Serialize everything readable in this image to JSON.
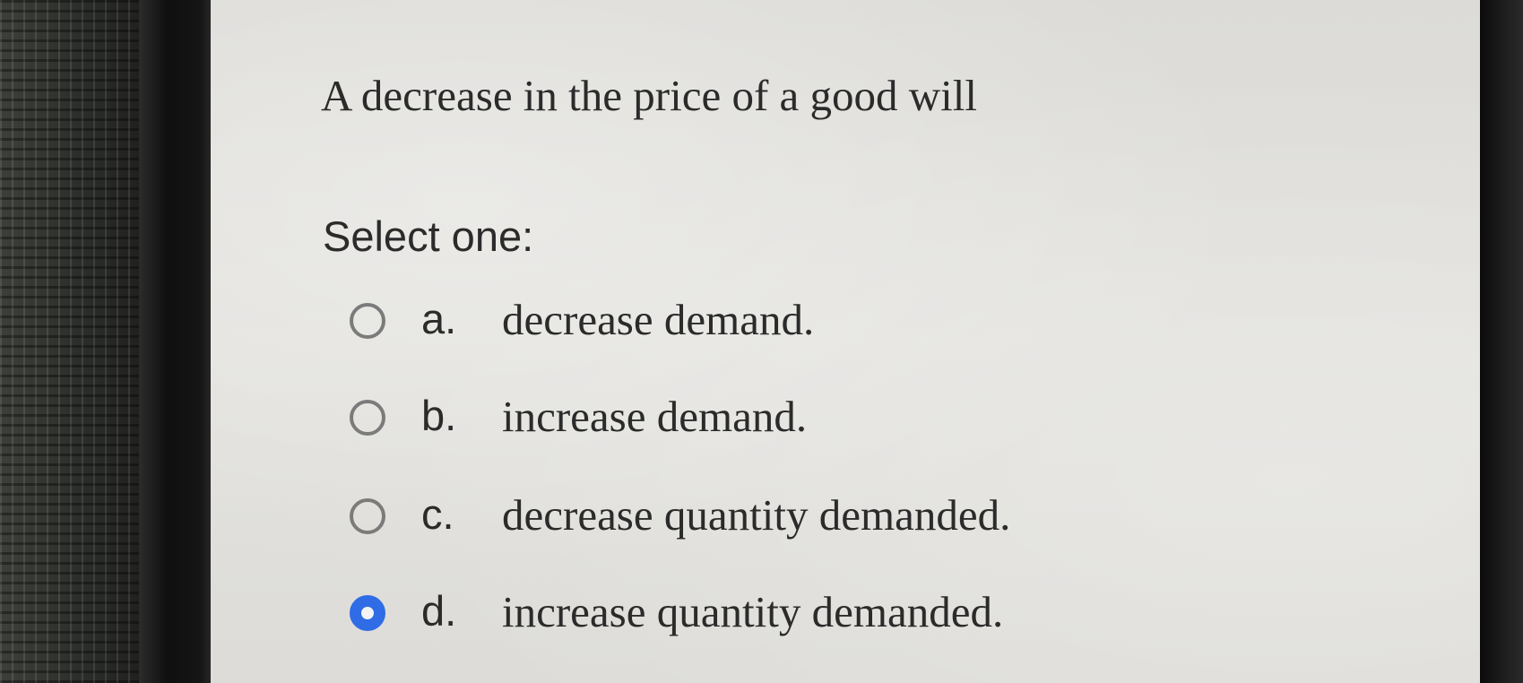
{
  "question": {
    "text": "A decrease in the price of a good will"
  },
  "prompt": "Select one:",
  "options": [
    {
      "letter": "a.",
      "text": "decrease demand.",
      "selected": false
    },
    {
      "letter": "b.",
      "text": "increase demand.",
      "selected": false
    },
    {
      "letter": "c.",
      "text": "decrease quantity demanded.",
      "selected": false
    },
    {
      "letter": "d.",
      "text": "increase quantity demanded.",
      "selected": true
    }
  ],
  "colors": {
    "selected_radio": "#2f6ce6",
    "unselected_radio": "#7b7b7b",
    "text": "#2b2b2b",
    "screen_bg": "#e0dfdb"
  }
}
